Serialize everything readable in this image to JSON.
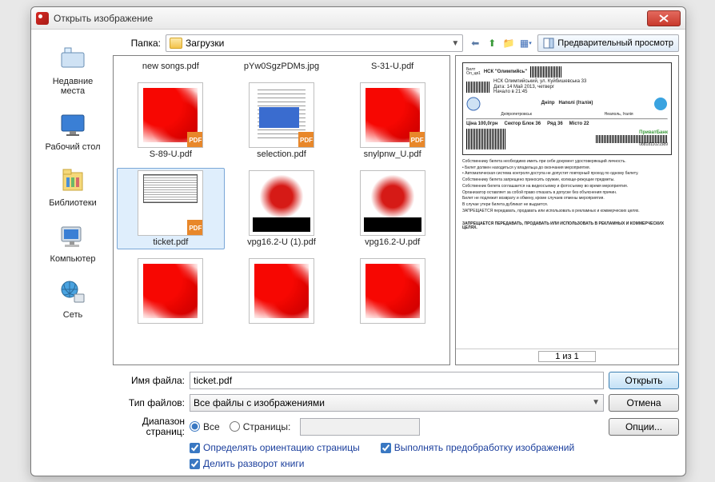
{
  "titlebar": {
    "title": "Открыть изображение"
  },
  "sidebar": {
    "items": [
      {
        "label": "Недавние места"
      },
      {
        "label": "Рабочий стол"
      },
      {
        "label": "Библиотеки"
      },
      {
        "label": "Компьютер"
      },
      {
        "label": "Сеть"
      }
    ]
  },
  "folder": {
    "label": "Папка:",
    "selected": "Загрузки"
  },
  "preview_toggle_label": "Предварительный просмотр",
  "files": [
    {
      "label": "new songs.pdf",
      "thumb": "textonly",
      "selected": false
    },
    {
      "label": "pYw0SgzPDMs.jpg",
      "thumb": "textonly",
      "selected": false
    },
    {
      "label": "S-31-U.pdf",
      "thumb": "textonly",
      "selected": false
    },
    {
      "label": "S-89-U.pdf",
      "thumb": "red",
      "badge": true,
      "selected": false
    },
    {
      "label": "selection.pdf",
      "thumb": "doc doc2",
      "badge": true,
      "selected": false
    },
    {
      "label": "snylpnw_U.pdf",
      "thumb": "red",
      "badge": true,
      "selected": false
    },
    {
      "label": "ticket.pdf",
      "thumb": "ticket-t",
      "badge": true,
      "selected": true
    },
    {
      "label": "vpg16.2-U (1).pdf",
      "thumb": "redblack",
      "selected": false
    },
    {
      "label": "vpg16.2-U.pdf",
      "thumb": "redblack",
      "selected": false
    },
    {
      "label": "",
      "thumb": "red",
      "selected": false
    },
    {
      "label": "",
      "thumb": "red",
      "selected": false
    },
    {
      "label": "",
      "thumb": "red",
      "selected": false
    }
  ],
  "preview": {
    "header_tag": "Билт\nОл_цв1",
    "venue": "НСК \"Олимпийсь\"",
    "address": "НСК Олимпийський, ул. Куйбишевська 33",
    "date": "Дата: 14 Май 2013, четверг",
    "start": "Начало в 21:45",
    "match_left": "Дніпр",
    "match_right": "Наполі (Італія)",
    "row1": "Дніпропетровськ",
    "row2": "Неаполь, Італія",
    "price_label": "Ціна 100,0грн",
    "sector": "Сектор Блок 36",
    "row": "Ряд 36",
    "seat": "Місто 22",
    "bank": "ПриватБанк",
    "barcode_num": "0881811021589",
    "page_indicator": "1 из 1"
  },
  "form": {
    "filename_label": "Имя файла:",
    "filename_value": "ticket.pdf",
    "filetype_label": "Тип файлов:",
    "filetype_value": "Все файлы с изображениями",
    "range_label": "Диапазон страниц:",
    "range_all": "Все",
    "range_pages": "Страницы:",
    "chk_orientation": "Определять ориентацию страницы",
    "chk_preprocess": "Выполнять предобработку изображений",
    "chk_split": "Делить разворот книги"
  },
  "buttons": {
    "open": "Открыть",
    "cancel": "Отмена",
    "options": "Опции..."
  }
}
